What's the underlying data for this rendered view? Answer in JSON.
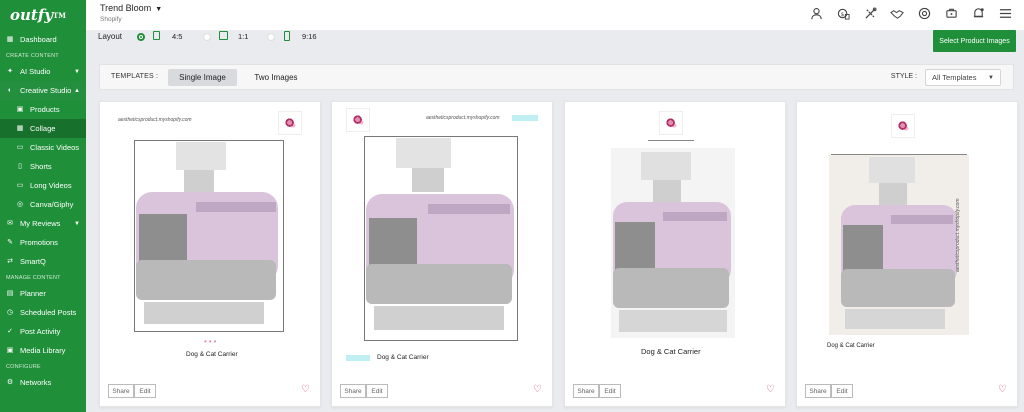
{
  "brand": {
    "logo": "outfy",
    "tm": "TM"
  },
  "sidebar": {
    "items": [
      {
        "label": "Dashboard",
        "icon": "dashboard-icon"
      },
      {
        "section": "CREATE CONTENT"
      },
      {
        "label": "AI Studio",
        "icon": "ai-studio-icon"
      },
      {
        "label": "Creative Studio",
        "icon": "palette-icon"
      },
      {
        "label": "Products",
        "icon": "products-icon"
      },
      {
        "label": "Collage",
        "icon": "collage-icon"
      },
      {
        "label": "Classic Videos",
        "icon": "video-icon"
      },
      {
        "label": "Shorts",
        "icon": "shorts-icon"
      },
      {
        "label": "Long Videos",
        "icon": "long-video-icon"
      },
      {
        "label": "Canva/Giphy",
        "icon": "canva-icon"
      },
      {
        "label": "My Reviews",
        "icon": "reviews-icon"
      },
      {
        "label": "Promotions",
        "icon": "promotions-icon"
      },
      {
        "label": "SmartQ",
        "icon": "smartq-icon"
      },
      {
        "section": "MANAGE CONTENT"
      },
      {
        "label": "Planner",
        "icon": "planner-icon"
      },
      {
        "label": "Scheduled Posts",
        "icon": "scheduled-icon"
      },
      {
        "label": "Post Activity",
        "icon": "activity-icon"
      },
      {
        "label": "Media Library",
        "icon": "media-icon"
      },
      {
        "section": "CONFIGURE"
      },
      {
        "label": "Networks",
        "icon": "networks-icon"
      }
    ]
  },
  "header": {
    "store_name": "Trend Bloom",
    "store_platform": "Shopify",
    "icons": [
      "user-icon",
      "billing-icon",
      "tools-icon",
      "handshake-icon",
      "support-icon",
      "cart-icon",
      "notification-icon",
      "menu-icon"
    ]
  },
  "layout": {
    "label": "Layout",
    "options": [
      {
        "label": "4:5",
        "selected": true
      },
      {
        "label": "1:1",
        "selected": false
      },
      {
        "label": "9:16",
        "selected": false
      }
    ],
    "select_button": "Select Product Images"
  },
  "templates": {
    "label": "TEMPLATES :",
    "tabs": [
      "Single Image",
      "Two Images"
    ],
    "active_tab": "Single Image",
    "style_label": "STYLE :",
    "style_value": "All Templates"
  },
  "cards": [
    {
      "url": "aestheticsproduct.myshopify.com",
      "title": "Dog & Cat Carrier",
      "share": "Share",
      "edit": "Edit"
    },
    {
      "url": "aestheticsproduct.myshopify.com",
      "title": "Dog & Cat Carrier",
      "share": "Share",
      "edit": "Edit"
    },
    {
      "url": "",
      "title": "Dog & Cat Carrier",
      "share": "Share",
      "edit": "Edit"
    },
    {
      "url": "aestheticsproduct.myshopify.com",
      "title": "Dog & Cat Carrier",
      "share": "Share",
      "edit": "Edit"
    }
  ],
  "colors": {
    "brand_green": "#1f8f3a",
    "carrier_pink": "#d9c4dc",
    "carrier_grey": "#b9b9b9"
  }
}
